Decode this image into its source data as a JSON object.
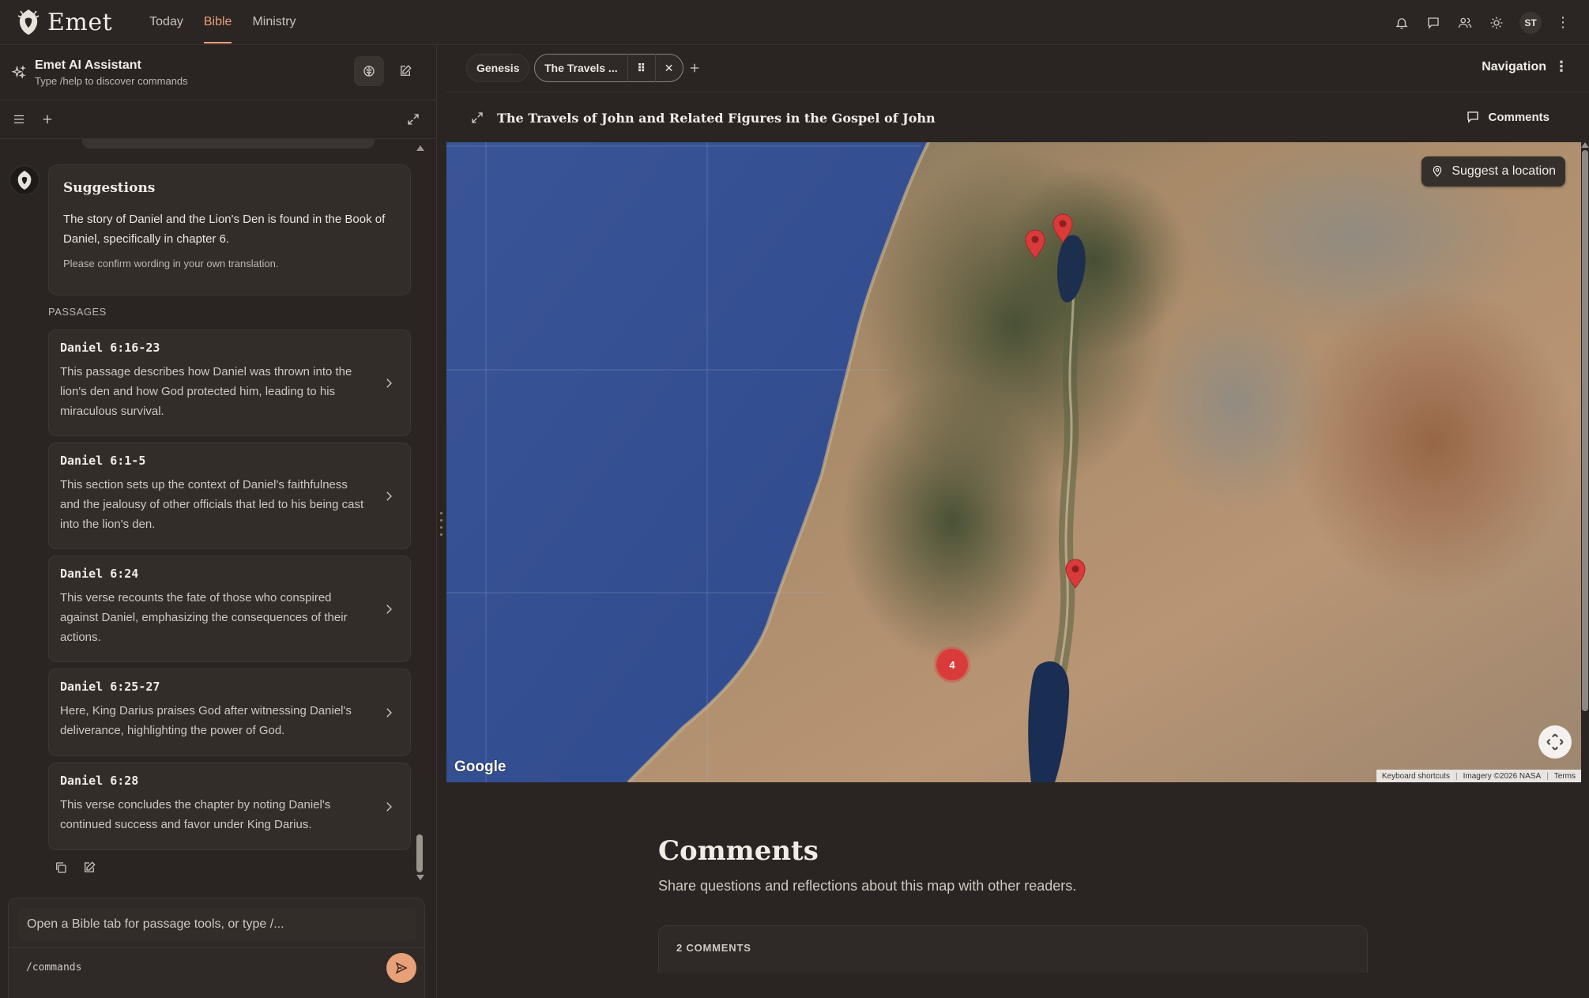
{
  "brand": {
    "name": "Emet",
    "accent": "#e8a078"
  },
  "nav": {
    "items": [
      {
        "label": "Today"
      },
      {
        "label": "Bible",
        "active": true
      },
      {
        "label": "Ministry"
      }
    ]
  },
  "topbar": {
    "icons": [
      "bell-icon",
      "chat-bubble-icon",
      "users-icon",
      "sun-icon"
    ],
    "avatar_initials": "ST"
  },
  "assistant": {
    "title": "Emet AI Assistant",
    "subtitle": "Type /help to discover commands",
    "suggestions": {
      "title": "Suggestions",
      "text": "The story of Daniel and the Lion's Den is found in the Book of Daniel, specifically in chapter 6.",
      "note": "Please confirm wording in your own translation."
    },
    "passages_label": "PASSAGES",
    "passages": [
      {
        "ref": "Daniel 6:16-23",
        "desc": "This passage describes how Daniel was thrown into the lion's den and how God protected him, leading to his miraculous survival."
      },
      {
        "ref": "Daniel 6:1-5",
        "desc": "This section sets up the context of Daniel's faithfulness and the jealousy of other officials that led to his being cast into the lion's den."
      },
      {
        "ref": "Daniel 6:24",
        "desc": "This verse recounts the fate of those who conspired against Daniel, emphasizing the consequences of their actions."
      },
      {
        "ref": "Daniel 6:25-27",
        "desc": "Here, King Darius praises God after witnessing Daniel's deliverance, highlighting the power of God."
      },
      {
        "ref": "Daniel 6:28",
        "desc": "This verse concludes the chapter by noting Daniel's continued success and favor under King Darius."
      }
    ],
    "composer": {
      "placeholder": "Open a Bible tab for passage tools, or type /...",
      "command_hint": "/commands"
    }
  },
  "tabs": {
    "items": [
      {
        "label": "Genesis"
      },
      {
        "label": "The Travels ...",
        "active": true
      }
    ],
    "navigation_label": "Navigation"
  },
  "map": {
    "title": "The Travels of John and Related Figures in the Gospel of John",
    "comments_button": "Comments",
    "suggest_label": "Suggest a location",
    "cluster_count": "4",
    "google_label": "Google",
    "attribution": [
      "Keyboard shortcuts",
      "Imagery ©2026 NASA",
      "Terms"
    ]
  },
  "comments": {
    "title": "Comments",
    "subtitle": "Share questions and reflections about this map with other readers.",
    "count_label": "2 COMMENTS"
  }
}
